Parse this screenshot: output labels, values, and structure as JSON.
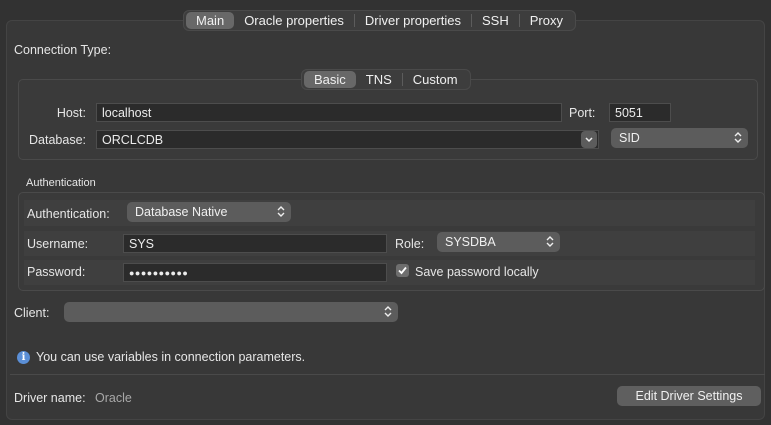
{
  "tabs": [
    {
      "label": "Main",
      "selected": true
    },
    {
      "label": "Oracle properties",
      "selected": false
    },
    {
      "label": "Driver properties",
      "selected": false
    },
    {
      "label": "SSH",
      "selected": false
    },
    {
      "label": "Proxy",
      "selected": false
    }
  ],
  "connection_type": {
    "label": "Connection Type:",
    "tabs": [
      {
        "label": "Basic",
        "selected": true
      },
      {
        "label": "TNS",
        "selected": false
      },
      {
        "label": "Custom",
        "selected": false
      }
    ],
    "host_label": "Host:",
    "host_value": "localhost",
    "port_label": "Port:",
    "port_value": "5051",
    "database_label": "Database:",
    "database_value": "ORCLCDB",
    "database_type": "SID"
  },
  "authentication": {
    "section_title": "Authentication",
    "auth_label": "Authentication:",
    "auth_value": "Database Native",
    "username_label": "Username:",
    "username_value": "SYS",
    "role_label": "Role:",
    "role_value": "SYSDBA",
    "password_label": "Password:",
    "password_masked": "●●●●●●●●●●",
    "save_password_label": "Save password locally",
    "save_password_checked": true
  },
  "client": {
    "label": "Client:",
    "value": ""
  },
  "info": {
    "icon": "info-icon",
    "text": "You can use variables in connection parameters."
  },
  "driver": {
    "label": "Driver name:",
    "value": "Oracle",
    "edit_button": "Edit Driver Settings"
  },
  "colors": {
    "background": "#323232",
    "selected_tab": "#686868",
    "popup": "#5c5c5c",
    "info_icon": "#5b8fd6"
  }
}
